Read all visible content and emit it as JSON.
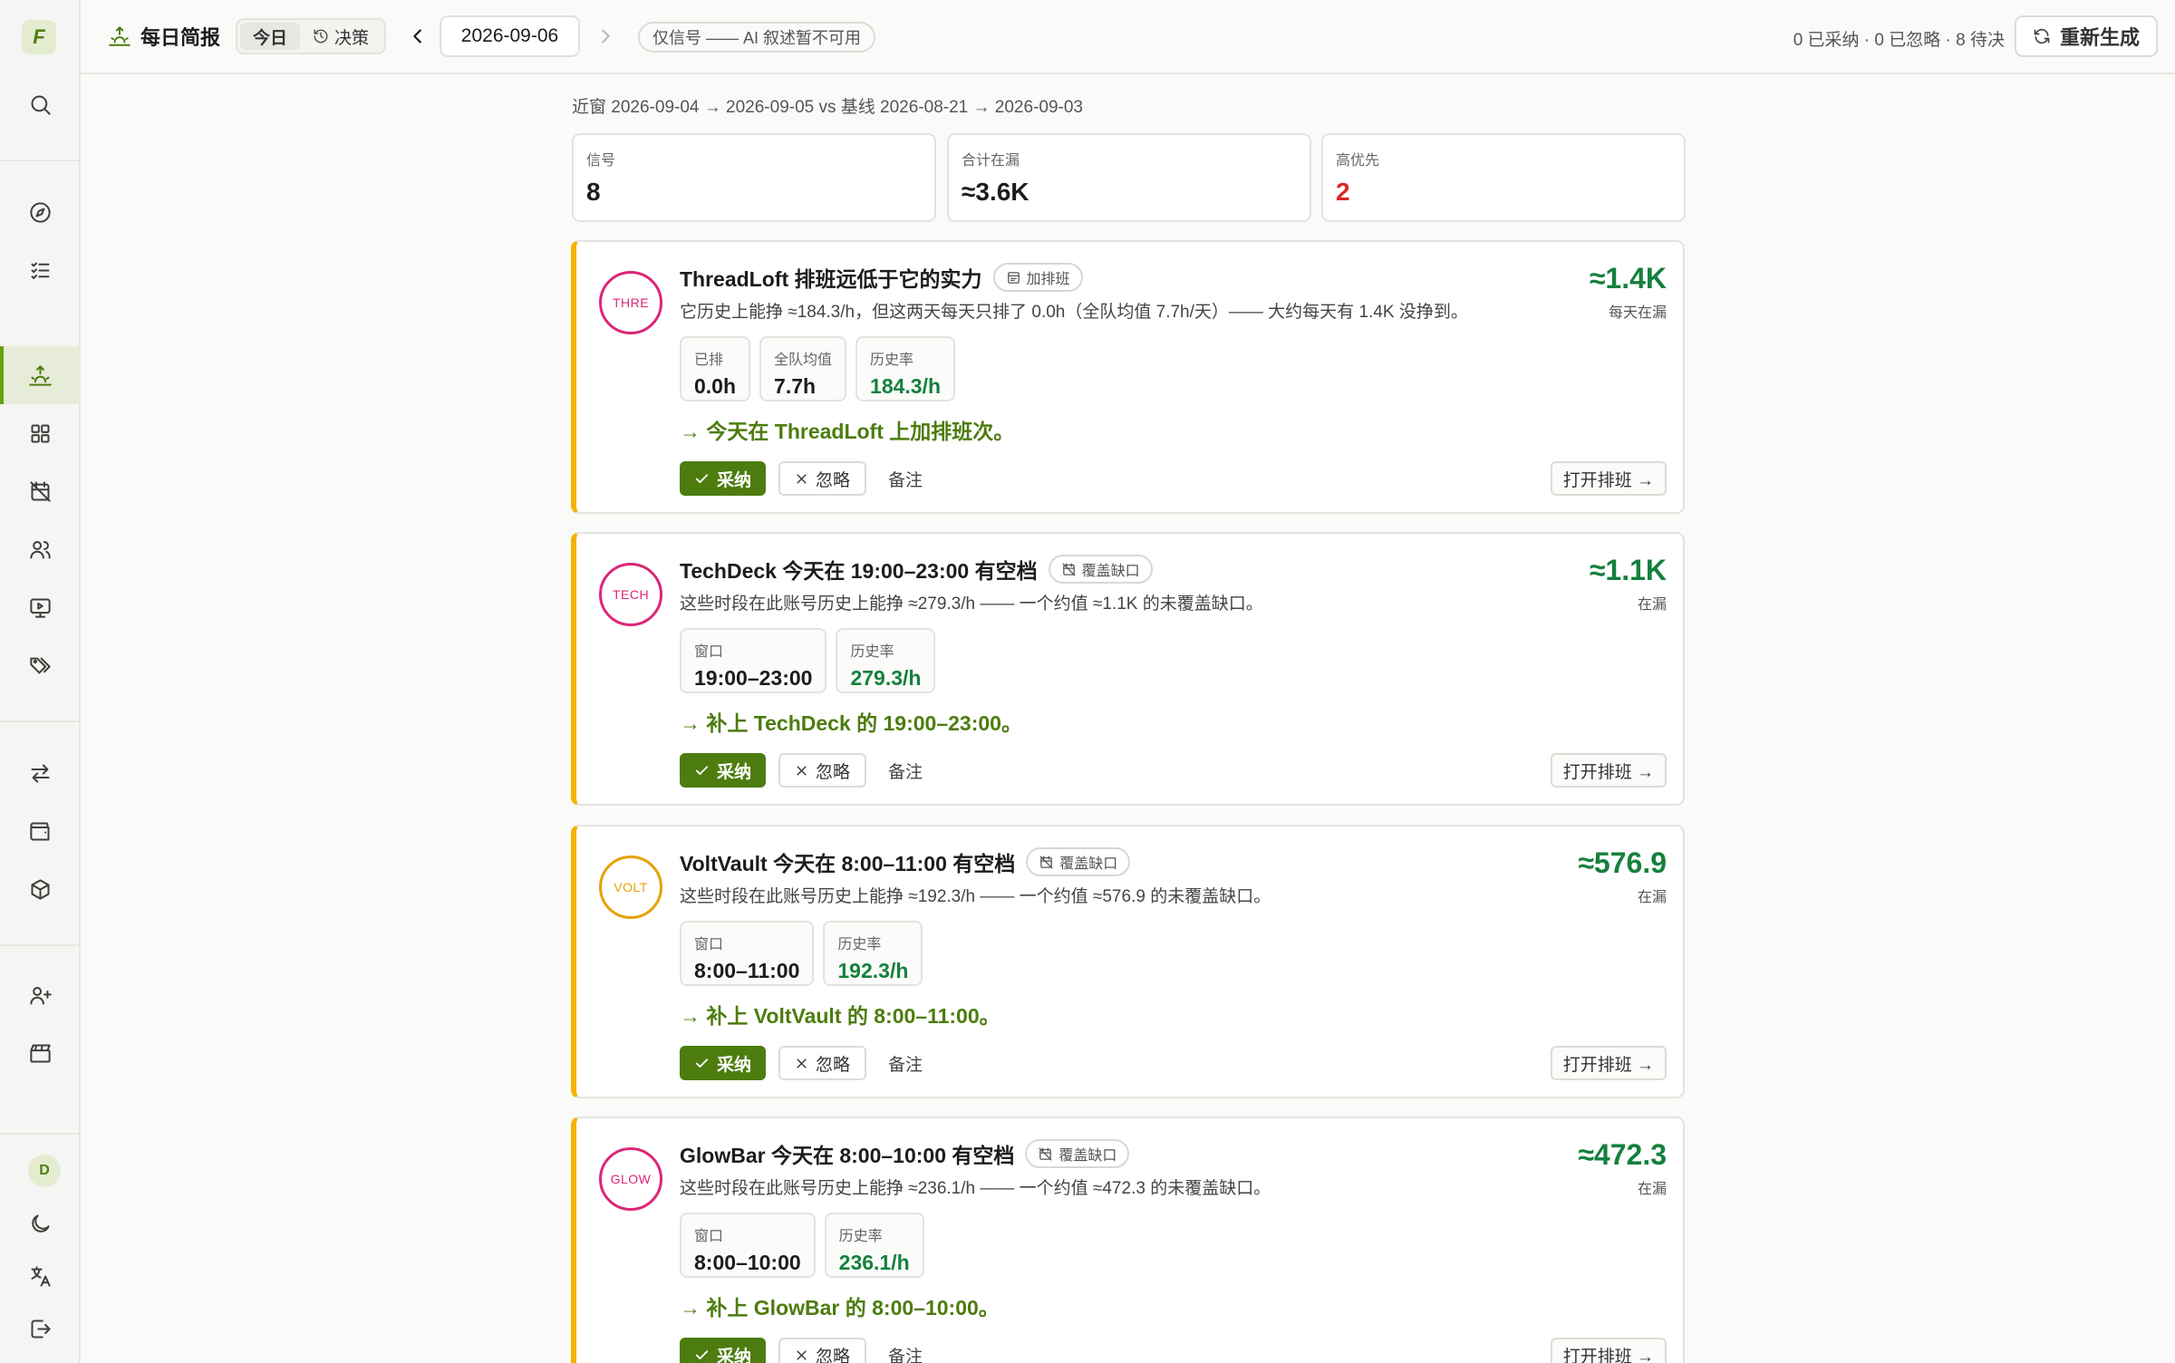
{
  "sidebar": {
    "logo": "F",
    "avatar": "D"
  },
  "header": {
    "title": "每日简报",
    "tabs": [
      {
        "label": "今日",
        "active": true
      },
      {
        "label": "决策",
        "active": false
      }
    ],
    "date": "2026-09-06",
    "notice": "仅信号 —— AI 叙述暂不可用",
    "stats": "0 已采纳 · 0 已忽略 · 8 待决",
    "regenerate": "重新生成"
  },
  "window_line": "近窗 2026-09-04 → 2026-09-05 vs 基线 2026-08-21 → 2026-09-03",
  "summary": [
    {
      "label": "信号",
      "value": "8"
    },
    {
      "label": "合计在漏",
      "value": "≈3.6K"
    },
    {
      "label": "高优先",
      "value": "2",
      "color": "#dc2626"
    }
  ],
  "cards": [
    {
      "badge": "THRE",
      "badge_color": "#db2777",
      "title": "ThreadLoft 排班远低于它的实力",
      "tag": "加排班",
      "tag_icon": "schedule-icon",
      "desc": "它历史上能挣 ≈184.3/h，但这两天每天只排了 0.0h（全队均值 7.7h/天）—— 大约每天有 1.4K 没挣到。",
      "metrics": [
        {
          "label": "已排",
          "value": "0.0h",
          "green": false
        },
        {
          "label": "全队均值",
          "value": "7.7h",
          "green": false
        },
        {
          "label": "历史率",
          "value": "184.3/h",
          "green": true
        }
      ],
      "action": "→ 今天在 ThreadLoft 上加排班次。",
      "amount": "≈1.4K",
      "amount_sub": "每天在漏",
      "accept": "采纳",
      "ignore": "忽略",
      "note": "备注",
      "open": "打开排班 →"
    },
    {
      "badge": "TECH",
      "badge_color": "#db2777",
      "title": "TechDeck 今天在 19:00–23:00 有空档",
      "tag": "覆盖缺口",
      "tag_icon": "calendar-off-icon",
      "desc": "这些时段在此账号历史上能挣 ≈279.3/h —— 一个约值 ≈1.1K 的未覆盖缺口。",
      "metrics": [
        {
          "label": "窗口",
          "value": "19:00–23:00",
          "green": false
        },
        {
          "label": "历史率",
          "value": "279.3/h",
          "green": true
        }
      ],
      "action": "→ 补上 TechDeck 的 19:00–23:00。",
      "amount": "≈1.1K",
      "amount_sub": "在漏",
      "accept": "采纳",
      "ignore": "忽略",
      "note": "备注",
      "open": "打开排班 →"
    },
    {
      "badge": "VOLT",
      "badge_color": "#e6a100",
      "title": "VoltVault 今天在 8:00–11:00 有空档",
      "tag": "覆盖缺口",
      "tag_icon": "calendar-off-icon",
      "desc": "这些时段在此账号历史上能挣 ≈192.3/h —— 一个约值 ≈576.9 的未覆盖缺口。",
      "metrics": [
        {
          "label": "窗口",
          "value": "8:00–11:00",
          "green": false
        },
        {
          "label": "历史率",
          "value": "192.3/h",
          "green": true
        }
      ],
      "action": "→ 补上 VoltVault 的 8:00–11:00。",
      "amount": "≈576.9",
      "amount_sub": "在漏",
      "accept": "采纳",
      "ignore": "忽略",
      "note": "备注",
      "open": "打开排班 →"
    },
    {
      "badge": "GLOW",
      "badge_color": "#db2777",
      "title": "GlowBar 今天在 8:00–10:00 有空档",
      "tag": "覆盖缺口",
      "tag_icon": "calendar-off-icon",
      "desc": "这些时段在此账号历史上能挣 ≈236.1/h —— 一个约值 ≈472.3 的未覆盖缺口。",
      "metrics": [
        {
          "label": "窗口",
          "value": "8:00–10:00",
          "green": false
        },
        {
          "label": "历史率",
          "value": "236.1/h",
          "green": true
        }
      ],
      "action": "→ 补上 GlowBar 的 8:00–10:00。",
      "amount": "≈472.3",
      "amount_sub": "在漏",
      "accept": "采纳",
      "ignore": "忽略",
      "note": "备注",
      "open": "打开排班 →"
    }
  ]
}
